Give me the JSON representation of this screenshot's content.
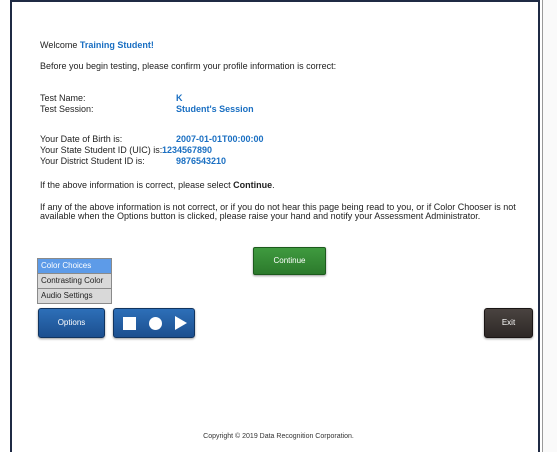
{
  "welcome": {
    "prefix": "Welcome",
    "name": "Training Student!"
  },
  "intro": "Before you begin testing, please confirm your profile information is correct:",
  "profile": {
    "test_name_label": "Test Name:",
    "test_name_value": "K",
    "test_session_label": "Test Session:",
    "test_session_value": "Student's Session",
    "dob_label": "Your Date of Birth is:",
    "dob_value": "2007-01-01T00:00:00",
    "uic_label": "Your State Student ID (UIC) is:",
    "uic_value": "1234567890",
    "district_label": "Your District Student ID is:",
    "district_value": "9876543210"
  },
  "confirm": {
    "text": "If the above information is correct, please select ",
    "emph": "Continue",
    "end": "."
  },
  "help_text": "If any of the above information is not correct, or if you do not hear this page being read to you, or if Color Chooser is not available when the Options button is clicked, please raise your hand and notify your Assessment Administrator.",
  "buttons": {
    "continue": "Continue",
    "options": "Options",
    "exit": "Exit"
  },
  "options_menu": [
    "Color Choices",
    "Contrasting Color",
    "Audio Settings"
  ],
  "media_controls": [
    "stop-icon",
    "record-icon",
    "play-icon"
  ],
  "footer": {
    "copyright": "Copyright © 2019 Data Recognition Corporation."
  },
  "colors": {
    "accent_blue": "#1a6fc2",
    "continue_green": "#2c7a2c",
    "options_blue": "#1c4f8f",
    "exit_dark": "#2e2826"
  }
}
